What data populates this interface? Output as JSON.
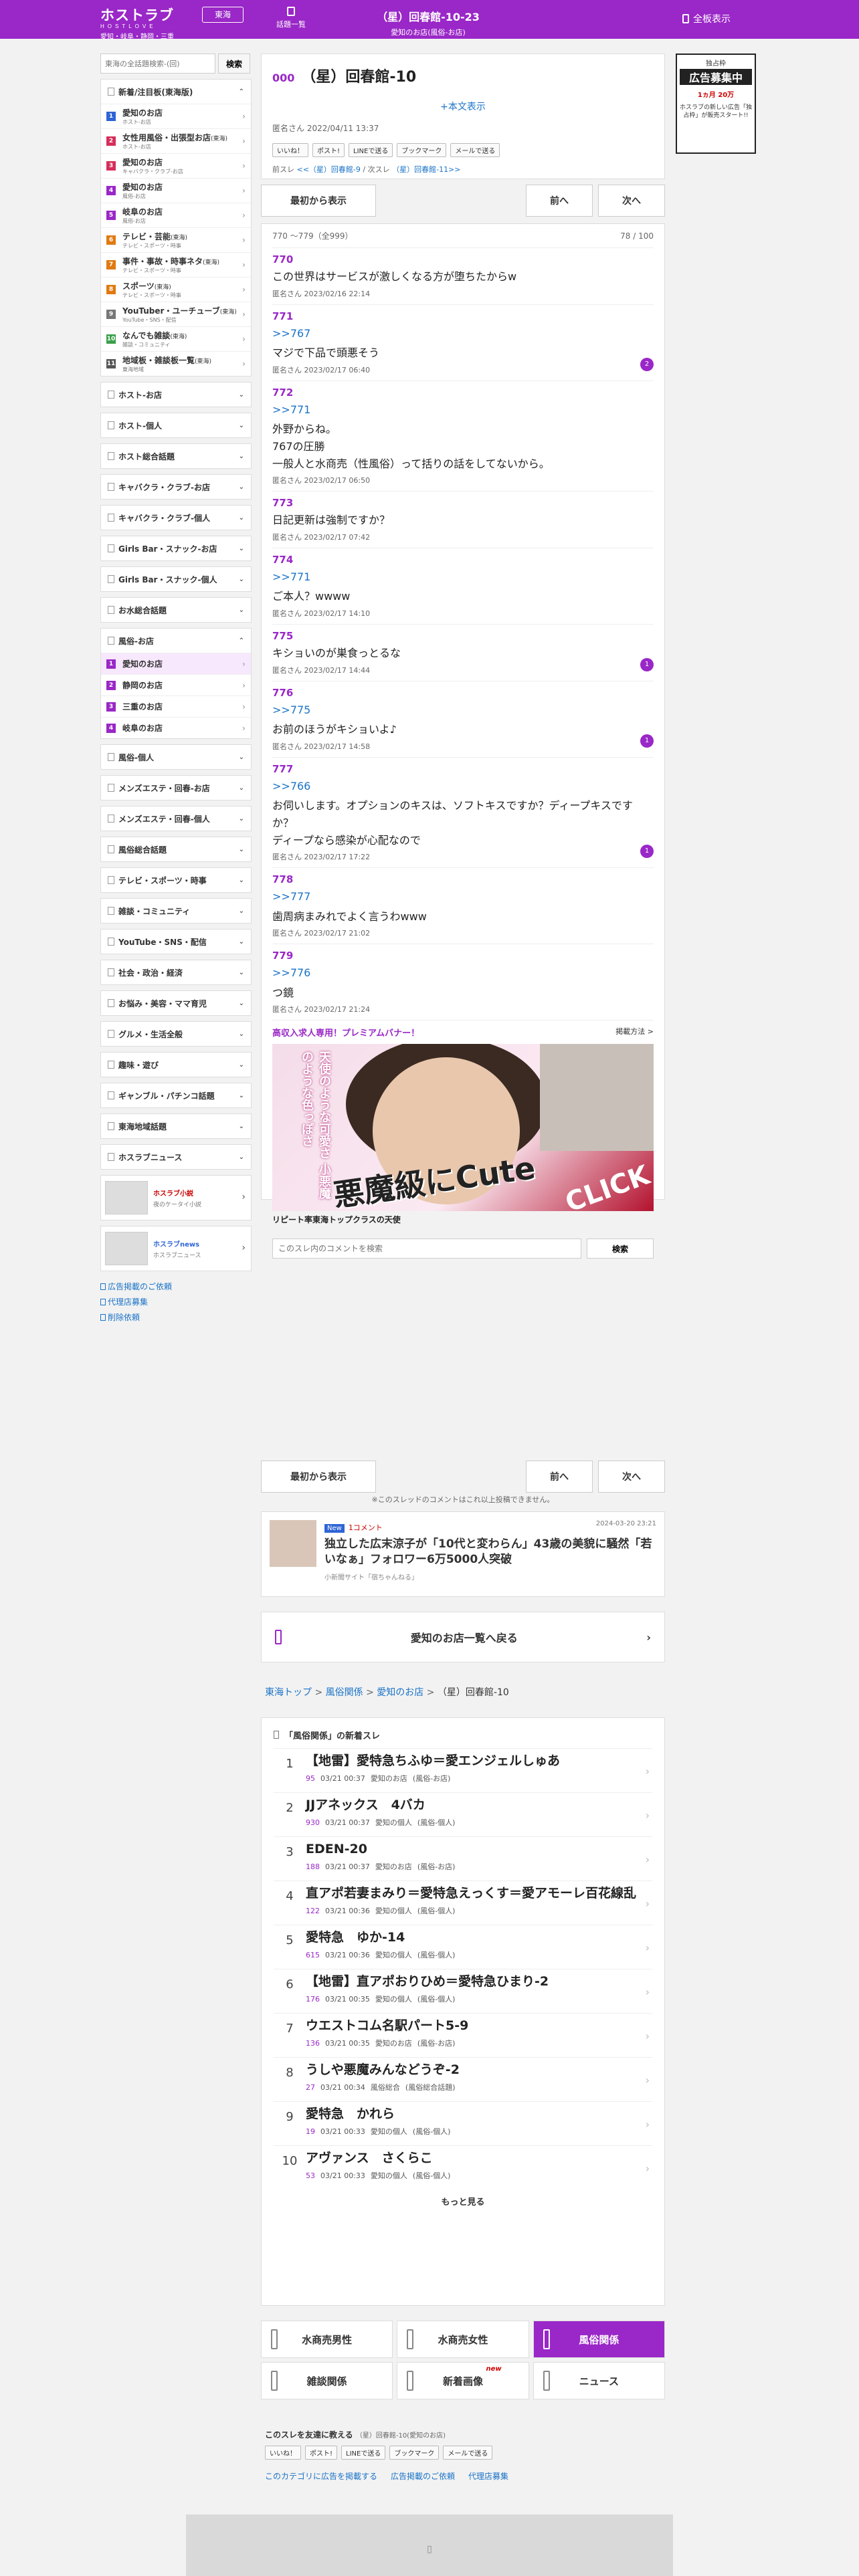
{
  "header": {
    "logo_top": "ホストラブ",
    "logo_mid": "HOSTLOVE",
    "logo_region": "愛知・岐阜・静岡・三重",
    "region_btn": "東海",
    "list_btn": "話題一覧",
    "thread_title": "（星）回春館-10-23",
    "thread_sub": "愛知のお店(風俗-お店)",
    "menu_label": "全板表示"
  },
  "sidebar": {
    "search_placeholder": "東海の全話題検索-(回)",
    "search_btn": "検索",
    "new_label": "新着/注目板(東海版)",
    "boards": [
      {
        "label": "愛知のお店",
        "sub": "ホスト-お店",
        "color": "#2e64d6"
      },
      {
        "label": "女性用風俗・出張型お店",
        "tag": "(東海)",
        "sub": "ホスト-お店",
        "color": "#d62e5a"
      },
      {
        "label": "愛知のお店",
        "sub": "キャバクラ・クラブ-お店",
        "color": "#d62e5a"
      },
      {
        "label": "愛知のお店",
        "sub": "風俗-お店",
        "color": "#9a27c7"
      },
      {
        "label": "岐阜のお店",
        "sub": "風俗-お店",
        "color": "#9a27c7"
      },
      {
        "label": "テレビ・芸能",
        "tag": "(東海)",
        "sub": "テレビ・スポーツ・時事",
        "color": "#e07a10"
      },
      {
        "label": "事件・事故・時事ネタ",
        "tag": "(東海)",
        "sub": "テレビ・スポーツ・時事",
        "color": "#e07a10"
      },
      {
        "label": "スポーツ",
        "tag": "(東海)",
        "sub": "テレビ・スポーツ・時事",
        "color": "#e07a10"
      },
      {
        "label": "YouTuber・ユーチューブ",
        "tag": "(東海)",
        "sub": "YouTube・SNS・配信",
        "color": "#777"
      },
      {
        "label": "なんでも雑談",
        "tag": "(東海)",
        "sub": "雑談・コミュニティ",
        "color": "#3aa04a"
      },
      {
        "label": "地域板・雑談板一覧",
        "tag": "(東海)",
        "sub": "東海地域",
        "color": "#555"
      }
    ],
    "cats": [
      "ホスト-お店",
      "ホスト-個人",
      "ホスト総合話題",
      "キャバクラ・クラブ-お店",
      "キャバクラ・クラブ-個人",
      "Girls Bar・スナック-お店",
      "Girls Bar・スナック-個人",
      "お水総合話題"
    ],
    "fuzoku": "風俗-お店",
    "fuzoku_items": [
      "愛知のお店",
      "静岡のお店",
      "三重のお店",
      "岐阜のお店"
    ],
    "cats2": [
      "風俗-個人",
      "メンズエステ・回春-お店",
      "メンズエステ・回春-個人",
      "風俗総合話題",
      "テレビ・スポーツ・時事",
      "雑談・コミュニティ",
      "YouTube・SNS・配信",
      "社会・政治・経済",
      "お悩み・美容・ママ育児",
      "グルメ・生活全般",
      "趣味・遊び",
      "ギャンブル・パチンコ話題",
      "東海地域話題",
      "ホスラブニュース"
    ],
    "banner1_title": "ホスラブ小説",
    "banner1_sub": "夜のケータイ小説",
    "banner2_title": "ホスラブnews",
    "banner2_sub": "ホスラブニュース",
    "links": [
      "広告掲載のご依頼",
      "代理店募集",
      "削除依頼"
    ]
  },
  "right_ad": {
    "l1": "独占枠",
    "l2": "広告募集中",
    "l3": "1ヵ月 20万",
    "l4": "ホスラブの新しい広告「独占枠」が販売スタート!!"
  },
  "op": {
    "no": "000",
    "title": "（星）回春館-10",
    "honbun": "+本文表示",
    "meta": "匿名さん 2022/04/11 13:37",
    "share": [
      "いいね！",
      "ポスト!",
      "LINEで送る",
      "ブックマーク",
      "メールで送る"
    ],
    "prev_label": "前スレ",
    "prev": "<<（星）回春館-9",
    "next_label": "次スレ",
    "next": "（星）回春館-11>>"
  },
  "nav": {
    "first": "最初から表示",
    "prev": "前へ",
    "next": "次へ"
  },
  "res_range": "770 〜779（全999）",
  "res_page": "78 / 100",
  "responses": [
    {
      "no": "770",
      "anchor": "",
      "text": "この世界はサービスが激しくなる方が堕ちたからw",
      "meta": "匿名さん 2023/02/16 22:14",
      "badge": ""
    },
    {
      "no": "771",
      "anchor": ">>767",
      "text": "マジで下品で頭悪そう",
      "meta": "匿名さん 2023/02/17 06:40",
      "badge": "2"
    },
    {
      "no": "772",
      "anchor": ">>771",
      "text": "外野からね。\n767の圧勝\n一般人と水商売（性風俗）って括りの話をしてないから。",
      "meta": "匿名さん 2023/02/17 06:50",
      "badge": ""
    },
    {
      "no": "773",
      "anchor": "",
      "text": "日記更新は強制ですか？",
      "meta": "匿名さん 2023/02/17 07:42",
      "badge": ""
    },
    {
      "no": "774",
      "anchor": ">>771",
      "text": "ご本人？wwww",
      "meta": "匿名さん 2023/02/17 14:10",
      "badge": ""
    },
    {
      "no": "775",
      "anchor": "",
      "text": "キショいのが巣食っとるな",
      "meta": "匿名さん 2023/02/17 14:44",
      "badge": "1"
    },
    {
      "no": "776",
      "anchor": ">>775",
      "text": "お前のほうがキショいよ♪",
      "meta": "匿名さん 2023/02/17 14:58",
      "badge": "1"
    },
    {
      "no": "777",
      "anchor": ">>766",
      "text": "お伺いします。オプションのキスは、ソフトキスですか？ディープキスですか？\nディープなら感染が心配なので",
      "meta": "匿名さん 2023/02/17 17:22",
      "badge": "1"
    },
    {
      "no": "778",
      "anchor": ">>777",
      "text": "歯周病まみれでよく言うわwww",
      "meta": "匿名さん 2023/02/17 21:02",
      "badge": ""
    },
    {
      "no": "779",
      "anchor": ">>776",
      "text": "つ鏡",
      "meta": "匿名さん 2023/02/17 21:24",
      "badge": ""
    }
  ],
  "premium": {
    "title": "高収入求人専用！プレミアムバナー！",
    "link": "掲載方法 >",
    "v1": "天使のような可愛さ",
    "v2": "小悪魔のような色っぽさ",
    "v3": "あなたは何が好き？",
    "big": "悪魔級にCute",
    "click": "CLICK",
    "cap": "リピート率東海トップクラスの天使"
  },
  "comment": {
    "placeholder": "このスレ内のコメントを検索",
    "btn": "検索"
  },
  "limit": "※このスレッドのコメントはこれ以上投稿できません。",
  "news": {
    "badge": "New",
    "count": "1コメント",
    "date": "2024-03-20 23:21",
    "title": "独立した広末涼子が「10代と変わらん」43歳の美貌に騒然「若いなぁ」フォロワー6万5000人突破",
    "source": "小新聞サイト「宿ちゃんねる」"
  },
  "backlist": "愛知のお店一覧へ戻る",
  "breadcrumb": [
    "東海トップ",
    "風俗関係",
    "愛知のお店",
    "（星）回春館-10"
  ],
  "newthreads": {
    "heading": "「風俗関係」の新着スレ",
    "more": "もっと見る",
    "items": [
      {
        "t": "【地雷】愛特急ちふゆ＝愛エンジェルしゅあ",
        "c": "95",
        "d": "03/21 00:37",
        "b": "愛知のお店",
        "k": "(風俗-お店)"
      },
      {
        "t": "JJアネックス　4バカ",
        "c": "930",
        "d": "03/21 00:37",
        "b": "愛知の個人",
        "k": "(風俗-個人)"
      },
      {
        "t": "EDEN-20",
        "c": "188",
        "d": "03/21 00:37",
        "b": "愛知のお店",
        "k": "(風俗-お店)"
      },
      {
        "t": "直アポ若妻まみり＝愛特急えっくす＝愛アモーレ百花線乱",
        "c": "122",
        "d": "03/21 00:36",
        "b": "愛知の個人",
        "k": "(風俗-個人)"
      },
      {
        "t": "愛特急　ゆか-14",
        "c": "615",
        "d": "03/21 00:36",
        "b": "愛知の個人",
        "k": "(風俗-個人)"
      },
      {
        "t": "【地雷】直アポおりひめ＝愛特急ひまり-2",
        "c": "176",
        "d": "03/21 00:35",
        "b": "愛知の個人",
        "k": "(風俗-個人)"
      },
      {
        "t": "ウエストコム名駅パート5-9",
        "c": "136",
        "d": "03/21 00:35",
        "b": "愛知のお店",
        "k": "(風俗-お店)"
      },
      {
        "t": "うしや悪魔みんなどうぞ-2",
        "c": "27",
        "d": "03/21 00:34",
        "b": "風俗総合",
        "k": "(風俗総合話題)"
      },
      {
        "t": "愛特急　かれら",
        "c": "19",
        "d": "03/21 00:33",
        "b": "愛知の個人",
        "k": "(風俗-個人)"
      },
      {
        "t": "アヴァンス　さくらこ",
        "c": "53",
        "d": "03/21 00:33",
        "b": "愛知の個人",
        "k": "(風俗-個人)"
      }
    ]
  },
  "categories": [
    {
      "label": "水商売男性"
    },
    {
      "label": "水商売女性"
    },
    {
      "label": "風俗関係",
      "active": true
    },
    {
      "label": "雑談関係"
    },
    {
      "label": "新着画像",
      "new": "new"
    },
    {
      "label": "ニュース"
    }
  ],
  "bottomshare": {
    "title": "このスレを友達に教える",
    "sub": "（星）回春館-10(愛知のお店)"
  },
  "bottomlinks": [
    "このカテゴリに広告を掲載する",
    "広告掲載のご依頼",
    "代理店募集"
  ],
  "colors": {
    "brand": "#9a27c7",
    "link": "#1a73c8"
  }
}
